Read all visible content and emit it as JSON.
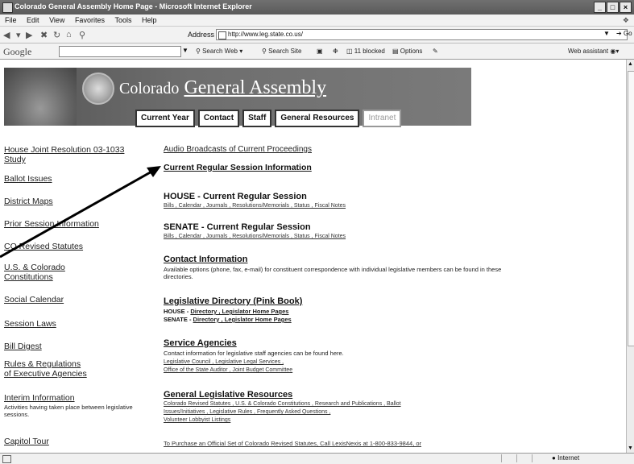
{
  "window": {
    "title": "Colorado General Assembly Home Page - Microsoft Internet Explorer",
    "controls": [
      "_",
      "□",
      "×"
    ]
  },
  "menu": {
    "items": [
      "File",
      "Edit",
      "View",
      "Favorites",
      "Tools",
      "Help"
    ]
  },
  "address": {
    "label": "Address",
    "url": "http://www.leg.state.co.us/",
    "go": "Go"
  },
  "google": {
    "logo": "Google",
    "search_web": "Search Web",
    "search_site": "Search Site",
    "blocked": "11 blocked",
    "options": "Options",
    "assistant": "Web assistant"
  },
  "header": {
    "state": "Colorado",
    "assembly": "General Assembly",
    "nav": [
      "Current Year",
      "Contact",
      "Staff",
      "General Resources",
      "Intranet"
    ]
  },
  "left": {
    "items": [
      "House Joint Resolution 03-1033",
      "Study",
      "Ballot Issues",
      "District Maps",
      "Prior Session Information",
      "CO Revised Statutes",
      "U.S. & Colorado",
      "Constitutions",
      "Social Calendar",
      "Session Laws",
      "Bill Digest",
      "Rules & Regulations",
      "of Executive Agencies",
      "Interim Information",
      "Capitol Tour"
    ],
    "interim_desc": "Activities having taken place between legislative sessions."
  },
  "right": {
    "audio": "Audio Broadcasts of Current Proceedings",
    "session_info": "Current Regular Session Information",
    "house_title": "HOUSE - Current Regular Session",
    "senate_title": "SENATE - Current Regular Session",
    "session_links": "Bills , Calendar , Journals , Resolutions/Memorials , Status , Fiscal Notes",
    "contact_title": "Contact Information",
    "contact_desc": "Available options (phone, fax, e-mail) for constituent correspondence with individual legislative members can be found in these directories.",
    "directory_title": "Legislative Directory (Pink Book)",
    "house_dir_prefix": "HOUSE -",
    "senate_dir_prefix": "SENATE -",
    "dir_links": "Directory , Legislator Home Pages",
    "service_title": "Service Agencies",
    "service_desc": "Contact information for legislative staff agencies can be found here.",
    "service_links1": "Legislative Council , Legislative Legal Services ,",
    "service_links2": "Office of the State Auditor , Joint Budget Committee",
    "resources_title": "General Legislative Resources",
    "resources_links1": "Colorado Revised Statutes , U.S. & Colorado Constitutions , Research and Publications , Ballot",
    "resources_links2": "Issues/Initiatives , Legislative Rules , Frequently Asked Questions ,",
    "resources_links3": "Volunteer Lobbyist Listings",
    "purchase": "To Purchase an Official Set of Colorado Revised Statutes, Call LexisNexis at 1-800-833-9844, or"
  },
  "status": {
    "zone": "Internet"
  }
}
